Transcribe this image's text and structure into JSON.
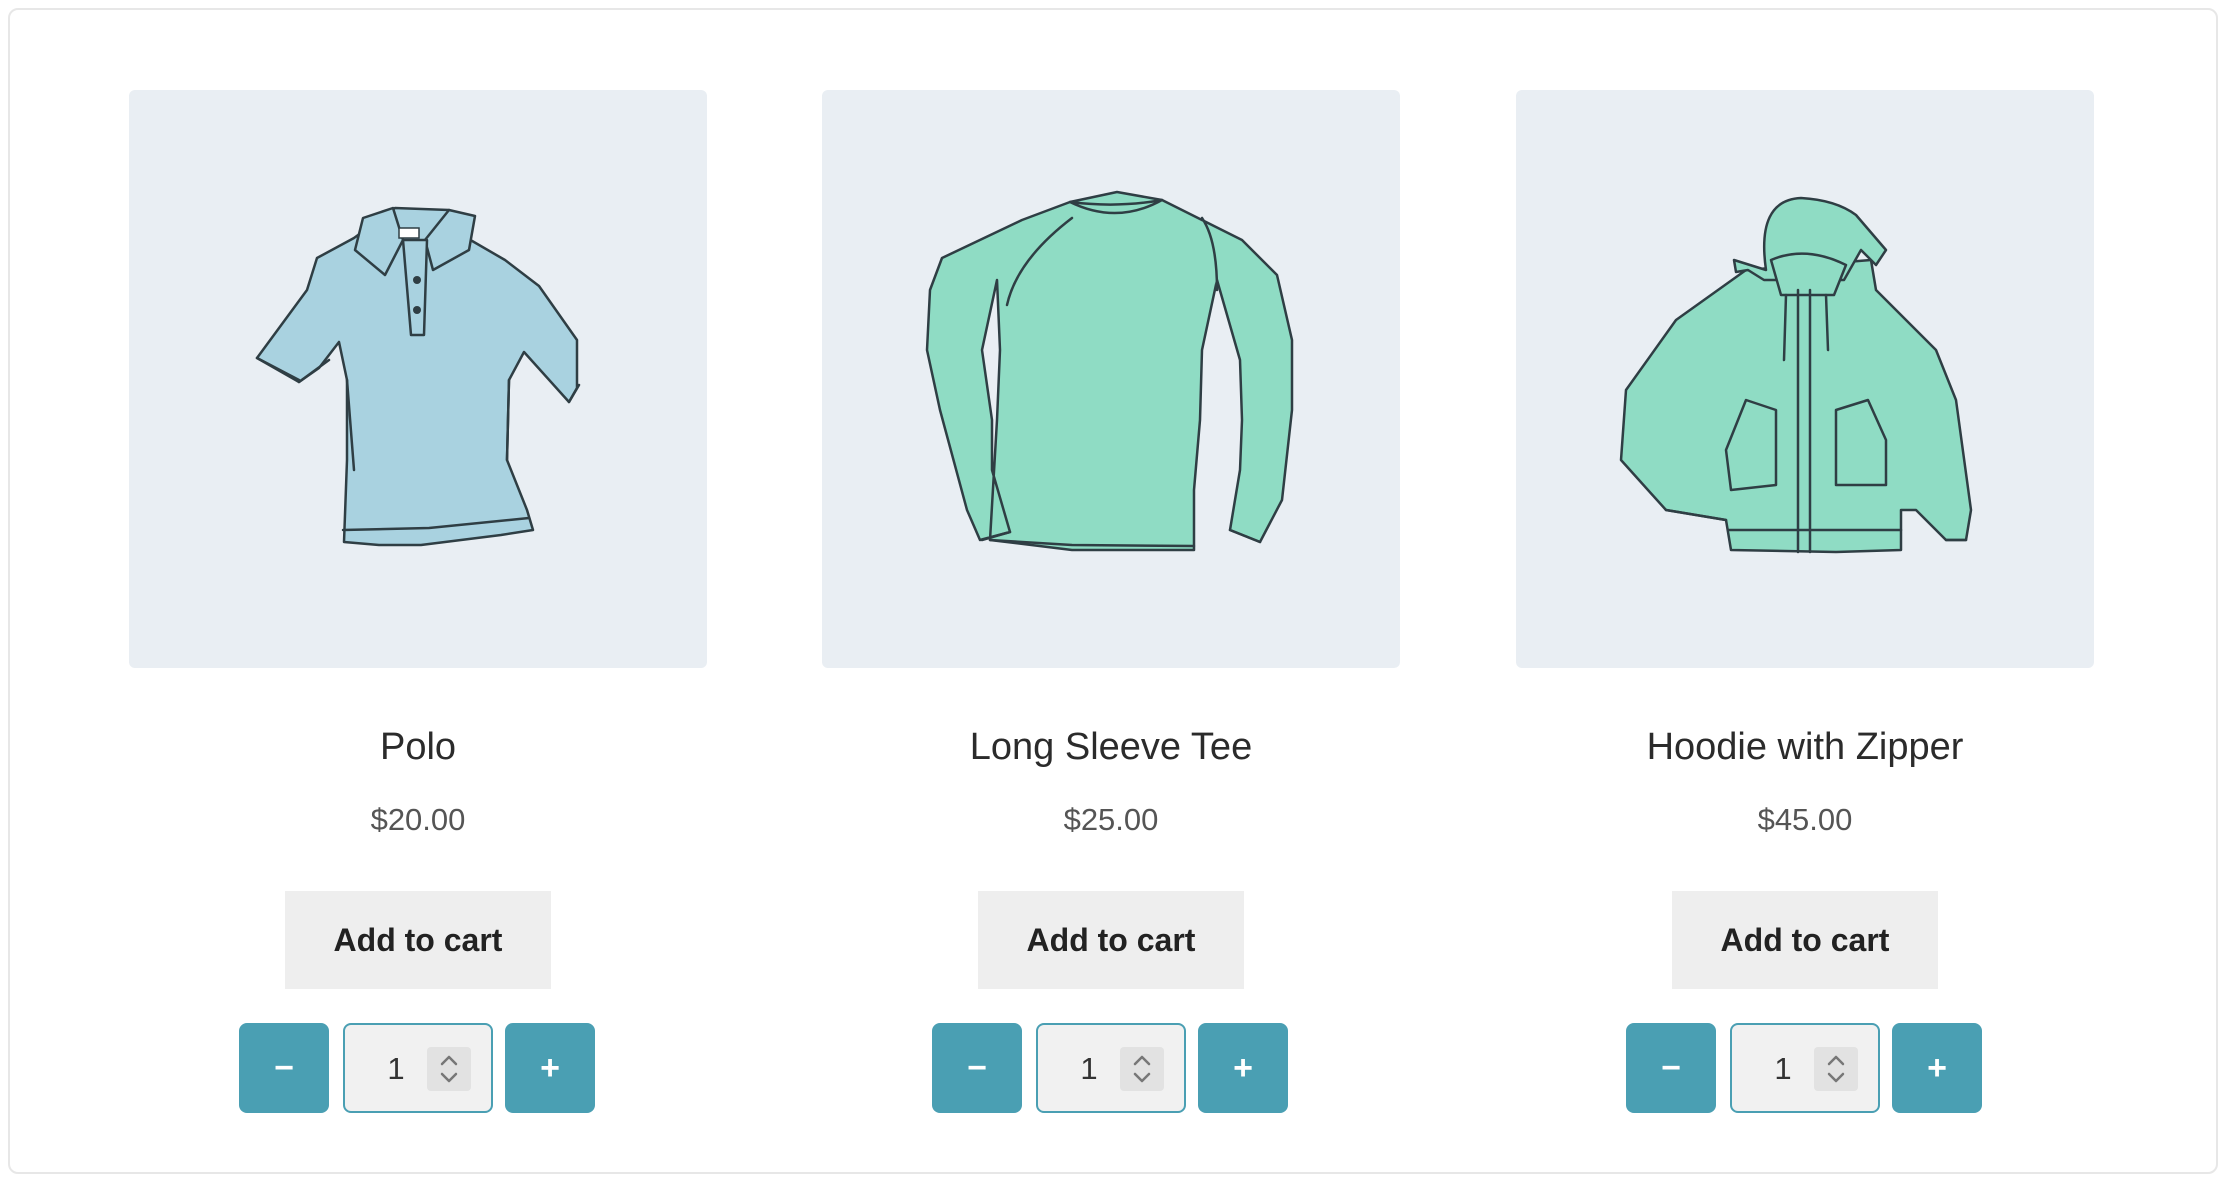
{
  "products": [
    {
      "title": "Polo",
      "price": "$20.00",
      "add_to_cart_label": "Add to cart",
      "quantity": "1",
      "minus_label": "−",
      "plus_label": "+",
      "image_icon": "polo-shirt-illustration",
      "garment_color": "#a9d2e0"
    },
    {
      "title": "Long Sleeve Tee",
      "price": "$25.00",
      "add_to_cart_label": "Add to cart",
      "quantity": "1",
      "minus_label": "−",
      "plus_label": "+",
      "image_icon": "long-sleeve-tee-illustration",
      "garment_color": "#8fdcc4"
    },
    {
      "title": "Hoodie with Zipper",
      "price": "$45.00",
      "add_to_cart_label": "Add to cart",
      "quantity": "1",
      "minus_label": "−",
      "plus_label": "+",
      "image_icon": "zip-hoodie-illustration",
      "garment_color": "#8fdcc4"
    }
  ],
  "colors": {
    "accent": "#4a9fb3",
    "image_background": "#e9eef3",
    "button_background": "#eeeeee"
  }
}
